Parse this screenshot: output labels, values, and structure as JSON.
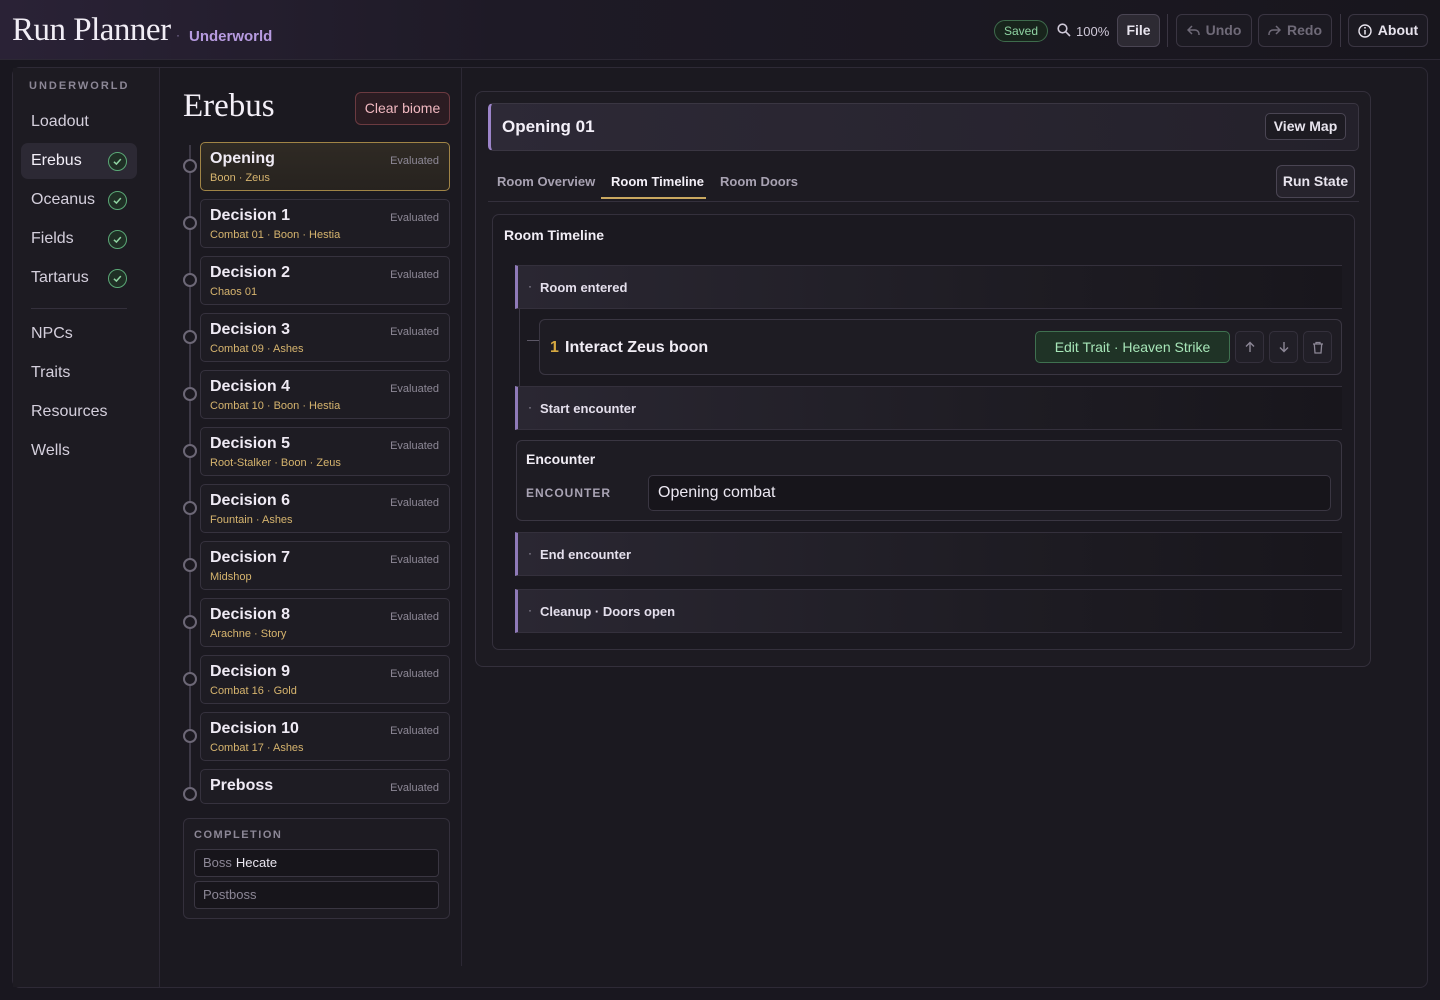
{
  "app": {
    "title": "Run Planner",
    "separator": "·",
    "subtitle": "Underworld"
  },
  "toolbar": {
    "saved": "Saved",
    "zoom": "100%",
    "file": "File",
    "undo": "Undo",
    "redo": "Redo",
    "about": "About"
  },
  "nav": {
    "heading": "UNDERWORLD",
    "items": [
      {
        "label": "Loadout",
        "checked": false
      },
      {
        "label": "Erebus",
        "checked": true,
        "active": true
      },
      {
        "label": "Oceanus",
        "checked": true
      },
      {
        "label": "Fields",
        "checked": true
      },
      {
        "label": "Tartarus",
        "checked": true
      }
    ],
    "secondary": [
      "NPCs",
      "Traits",
      "Resources",
      "Wells"
    ]
  },
  "biome": {
    "title": "Erebus",
    "clear_label": "Clear biome",
    "rooms": [
      {
        "name": "Opening",
        "sub": "Boon · Zeus",
        "status": "Evaluated"
      },
      {
        "name": "Decision 1",
        "sub": "Combat 01 · Boon · Hestia",
        "status": "Evaluated"
      },
      {
        "name": "Decision 2",
        "sub": "Chaos 01",
        "status": "Evaluated"
      },
      {
        "name": "Decision 3",
        "sub": "Combat 09 · Ashes",
        "status": "Evaluated"
      },
      {
        "name": "Decision 4",
        "sub": "Combat 10 · Boon · Hestia",
        "status": "Evaluated"
      },
      {
        "name": "Decision 5",
        "sub": "Root-Stalker · Boon · Zeus",
        "status": "Evaluated"
      },
      {
        "name": "Decision 6",
        "sub": "Fountain · Ashes",
        "status": "Evaluated"
      },
      {
        "name": "Decision 7",
        "sub": "Midshop",
        "status": "Evaluated"
      },
      {
        "name": "Decision 8",
        "sub": "Arachne · Story",
        "status": "Evaluated"
      },
      {
        "name": "Decision 9",
        "sub": "Combat 16 · Gold",
        "status": "Evaluated"
      },
      {
        "name": "Decision 10",
        "sub": "Combat 17 · Ashes",
        "status": "Evaluated"
      },
      {
        "name": "Preboss",
        "sub": "",
        "status": "Evaluated"
      }
    ],
    "completion": {
      "heading": "COMPLETION",
      "boss_label": "Boss",
      "boss_value": "Hecate",
      "postboss_label": "Postboss"
    }
  },
  "room": {
    "title": "Opening 01",
    "view_map": "View Map",
    "tabs": [
      "Room Overview",
      "Room Timeline",
      "Room Doors"
    ],
    "active_tab": "Room Timeline",
    "run_state": "Run State",
    "timeline": {
      "title": "Room Timeline",
      "bullet": "·",
      "phases": [
        "Room entered",
        "Start encounter",
        "End encounter",
        "Cleanup · Doors open"
      ],
      "action": {
        "num": "1",
        "text": "Interact Zeus boon",
        "trait": "Edit Trait · Heaven Strike"
      },
      "encounter": {
        "heading": "Encounter",
        "label": "ENCOUNTER",
        "value": "Opening combat"
      }
    }
  },
  "colors": {
    "accent": "#9c84c9",
    "gold": "#d6b46e",
    "success": "#5aa876",
    "danger": "#f0b8c0"
  }
}
